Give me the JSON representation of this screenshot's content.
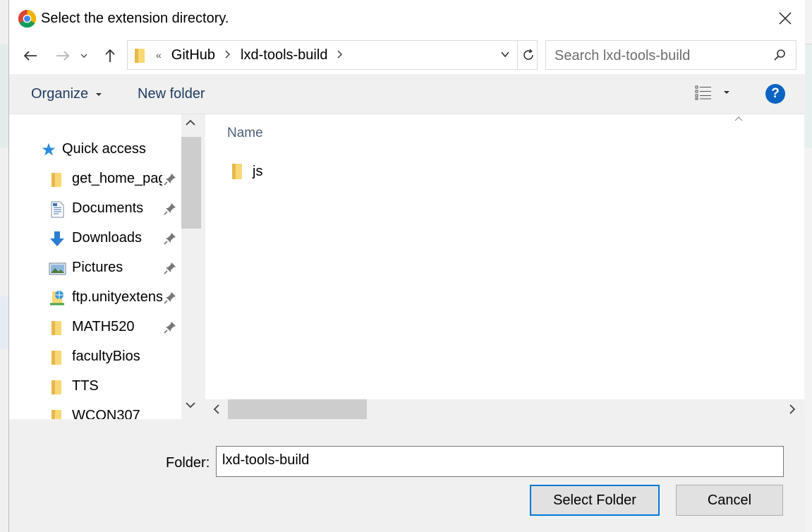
{
  "window": {
    "title": "Select the extension directory.",
    "app_icon": "chrome-icon",
    "close_icon": "close-icon"
  },
  "navigation": {
    "back_icon": "arrow-left-icon",
    "forward_icon": "arrow-right-icon",
    "recent_icon": "chevron-down-icon",
    "up_icon": "arrow-up-icon",
    "breadcrumb_overflow": "«",
    "breadcrumb": [
      "GitHub",
      "lxd-tools-build"
    ],
    "refresh_icon": "refresh-icon",
    "search_placeholder": "Search lxd-tools-build"
  },
  "toolbar": {
    "organize_label": "Organize",
    "new_folder_label": "New folder",
    "view_icon": "details-view-icon",
    "help_label": "?"
  },
  "sidebar": {
    "quick_access_label": "Quick access",
    "items": [
      {
        "label": "get_home_page",
        "icon": "folder-icon",
        "pinned": true
      },
      {
        "label": "Documents",
        "icon": "documents-icon",
        "pinned": true
      },
      {
        "label": "Downloads",
        "icon": "downloads-icon",
        "pinned": true
      },
      {
        "label": "Pictures",
        "icon": "pictures-icon",
        "pinned": true
      },
      {
        "label": "ftp.unityextension",
        "icon": "network-location-icon",
        "pinned": true
      },
      {
        "label": "MATH520",
        "icon": "folder-icon",
        "pinned": true
      },
      {
        "label": "facultyBios",
        "icon": "folder-icon",
        "pinned": false
      },
      {
        "label": "TTS",
        "icon": "folder-icon",
        "pinned": false
      },
      {
        "label": "WCON307",
        "icon": "folder-icon",
        "pinned": false
      }
    ]
  },
  "file_list": {
    "column_name": "Name",
    "items": [
      {
        "name": "js",
        "icon": "folder-icon"
      }
    ]
  },
  "footer": {
    "folder_label": "Folder:",
    "folder_value": "lxd-tools-build",
    "select_button": "Select Folder",
    "cancel_button": "Cancel"
  }
}
